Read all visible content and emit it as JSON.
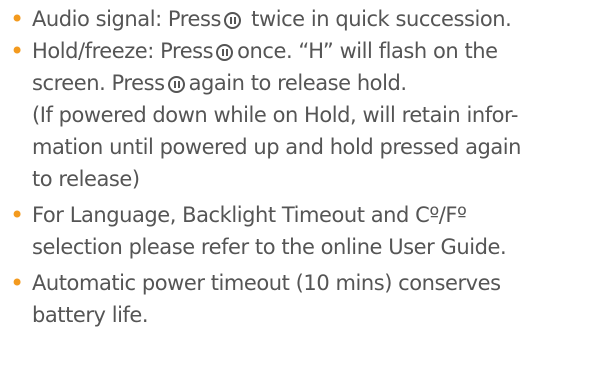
{
  "colors": {
    "text": "#555555",
    "bullet": "#f39a1e"
  },
  "icons": {
    "hold": "hold-pause-circle-icon"
  },
  "items": [
    {
      "bullet": "•",
      "lines": [
        {
          "a": "Audio signal:  Press",
          "b": " twice in quick succession."
        }
      ]
    },
    {
      "bullet": "•",
      "lines": [
        {
          "a": "Hold/freeze: Press",
          "b": "once.  “H” will flash on the"
        },
        {
          "a": "screen. Press",
          "b": "again to release hold."
        },
        {
          "a": "(If powered down while on Hold, will retain infor-"
        },
        {
          "a": "mation until powered up and hold pressed again"
        },
        {
          "a": "to release)"
        }
      ]
    },
    {
      "bullet": "•",
      "lines": [
        {
          "a": "For Language, Backlight Timeout and Cº/Fº"
        },
        {
          "a": "selection please refer to the online User Guide."
        }
      ]
    },
    {
      "bullet": "•",
      "lines": [
        {
          "a": "Automatic power timeout (10 mins) conserves"
        },
        {
          "a": " battery life."
        }
      ]
    }
  ]
}
